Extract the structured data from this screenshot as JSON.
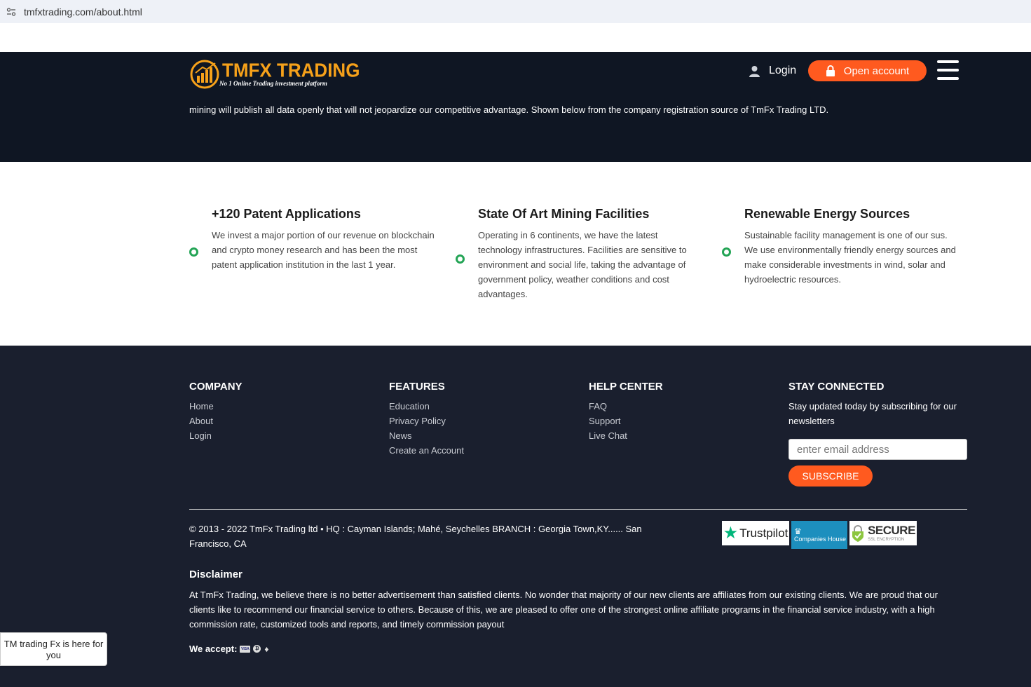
{
  "browser": {
    "url": "tmfxtrading.com/about.html"
  },
  "header": {
    "logo_title": "TMFX TRADING",
    "logo_tagline": "No 1 Online Trading investment platform",
    "login_label": "Login",
    "open_account_label": "Open account",
    "intro_text": "mining will publish all data openly that will not jeopardize our competitive advantage. Shown below from the company registration source of TmFx Trading LTD."
  },
  "features": [
    {
      "title": "+120 Patent Applications",
      "text": "We invest a major portion of our revenue on blockchain and crypto money research and has been the most patent application institution in the last 1 year."
    },
    {
      "title": "State Of Art Mining Facilities",
      "text": "Operating in 6 continents, we have the latest technology infrastructures. Facilities are sensitive to environment and social life, taking the advantage of government policy, weather conditions and cost advantages."
    },
    {
      "title": "Renewable Energy Sources",
      "text": "Sustainable facility management is one of our sus. We use environmentally friendly energy sources and make considerable investments in wind, solar and hydroelectric resources."
    }
  ],
  "footer": {
    "company": {
      "heading": "COMPANY",
      "links": [
        "Home",
        "About",
        "Login"
      ]
    },
    "features": {
      "heading": "FEATURES",
      "links": [
        "Education",
        "Privacy Policy",
        "News",
        "Create an Account"
      ]
    },
    "help": {
      "heading": "HELP CENTER",
      "links": [
        "FAQ",
        "Support",
        "Live Chat"
      ]
    },
    "stay": {
      "heading": "STAY CONNECTED",
      "text": "Stay updated today by subscribing for our newsletters",
      "email_placeholder": "enter email address",
      "subscribe_label": "SUBSCRIBE"
    },
    "copyright": "© 2013 - 2022 TmFx Trading ltd • HQ : Cayman Islands; Mahé, Seychelles BRANCH : Georgia Town,KY...... San Francisco, CA",
    "badges": {
      "trustpilot": "Trustpilot",
      "companies_house": "Companies House",
      "secure": "SECURE",
      "secure_sub": "SSL ENCRYPTION"
    },
    "disclaimer_title": "Disclaimer",
    "disclaimer_text": "At TmFx Trading, we believe there is no better advertisement than satisfied clients. No wonder that majority of our new clients are affiliates from our existing clients. We are proud that our clients like to recommend our financial service to others. Because of this, we are pleased to offer one of the strongest online affiliate programs in the financial service industry, with a high commission rate, customized tools and reports, and timely commission payout",
    "we_accept_label": "We accept:",
    "visa_label": "VISA",
    "btc_label": "₿"
  },
  "chat_widget": {
    "text": "TM trading Fx is here for you"
  },
  "colors": {
    "header_bg": "#0f1623",
    "footer_bg": "#1a1f2e",
    "accent": "#ff5a1f",
    "logo_gold": "#f6a11a",
    "bullet_green": "#23a455"
  }
}
